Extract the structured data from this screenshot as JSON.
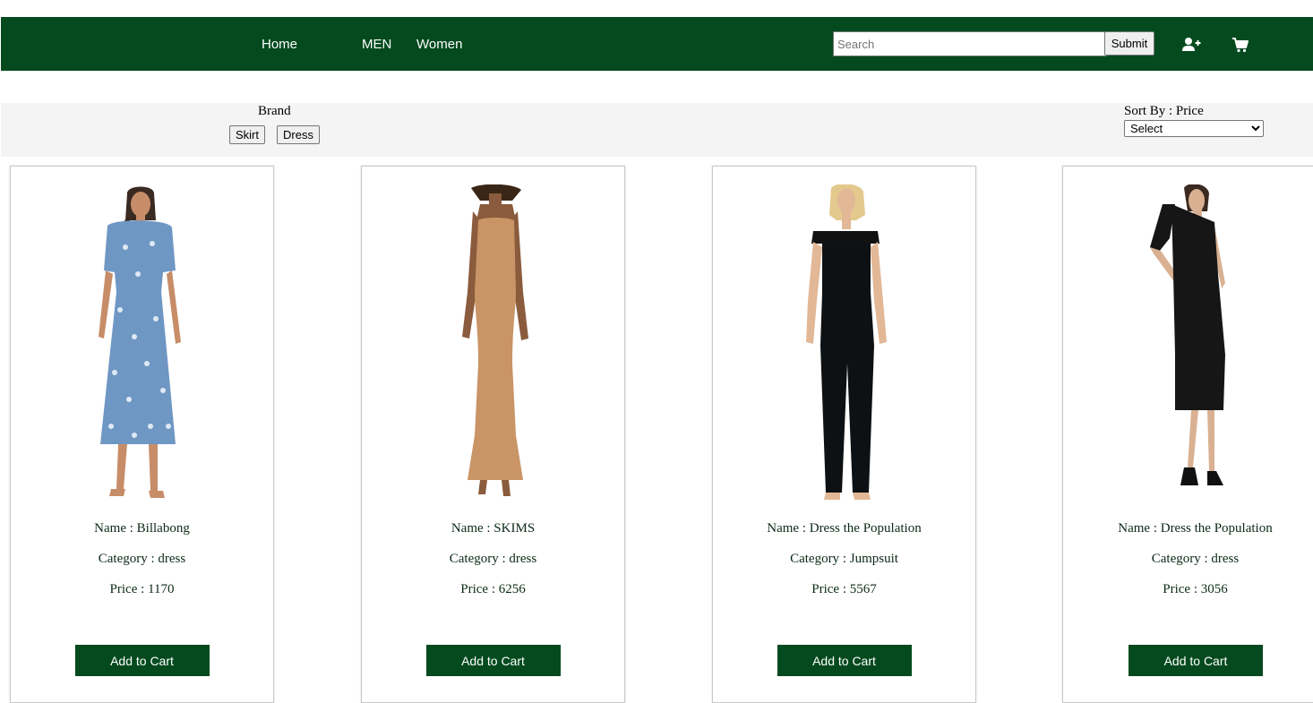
{
  "nav": {
    "links": [
      {
        "label": "Home"
      },
      {
        "label": "MEN"
      },
      {
        "label": "Women"
      }
    ],
    "search": {
      "placeholder": "Search",
      "value": ""
    },
    "submit_label": "Submit",
    "icons": [
      "add-user-icon",
      "cart-icon"
    ],
    "bg_color": "#044a1e"
  },
  "filters": {
    "brand_label": "Brand",
    "buttons": [
      "Skirt",
      "Dress"
    ],
    "sort_label": "Sort By : Price",
    "sort_selected": "Select"
  },
  "products": [
    {
      "name": "Name : Billabong",
      "category": "Category : dress",
      "price": "Price : 1170",
      "button": "Add to Cart",
      "image": "blue floral midi dress"
    },
    {
      "name": "Name : SKIMS",
      "category": "Category : dress",
      "price": "Price : 6256",
      "button": "Add to Cart",
      "image": "tan ribbed maxi dress"
    },
    {
      "name": "Name : Dress the Population",
      "category": "Category : Jumpsuit",
      "price": "Price : 5567",
      "button": "Add to Cart",
      "image": "black off-shoulder jumpsuit"
    },
    {
      "name": "Name : Dress the Population",
      "category": "Category : dress",
      "price": "Price : 3056",
      "button": "Add to Cart",
      "image": "black one-shoulder midi dress"
    }
  ]
}
